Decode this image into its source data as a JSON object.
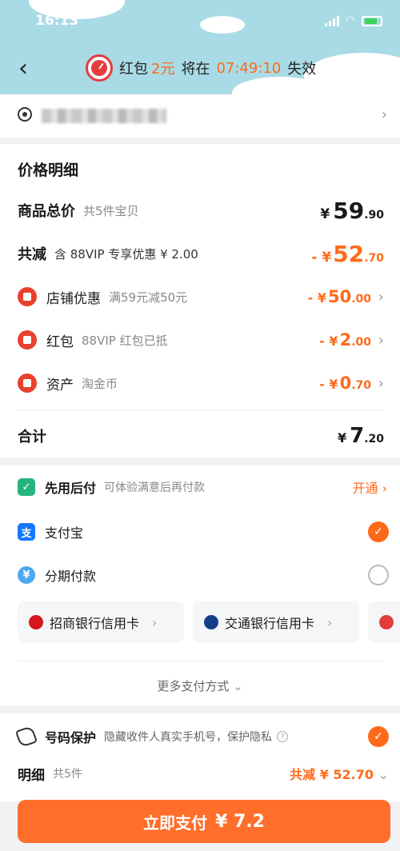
{
  "status": {
    "time": "16:13"
  },
  "header": {
    "countdown_prefix": "红包",
    "countdown_amount": "2元",
    "countdown_mid": "将在",
    "countdown_time": "07:49:10",
    "countdown_suffix": "失效"
  },
  "price": {
    "title": "价格明细",
    "total_label": "商品总价",
    "total_sub": "共5件宝贝",
    "total_currency": "¥",
    "total_int": "59",
    "total_dec": ".90",
    "discount_label": "共减",
    "discount_sub": "含 88VIP 专享优惠 ¥ 2.00",
    "discount_prefix": "- ¥",
    "discount_int": "52",
    "discount_dec": ".70",
    "items": [
      {
        "label": "店铺优惠",
        "sub": "满59元减50元",
        "prefix": "- ¥",
        "int": "50",
        "dec": ".00"
      },
      {
        "label": "红包",
        "sub": "88VIP 红包已抵",
        "prefix": "- ¥",
        "int": "2",
        "dec": ".00"
      },
      {
        "label": "资产",
        "sub": "淘金币",
        "prefix": "- ¥",
        "int": "0",
        "dec": ".70"
      }
    ],
    "sum_label": "合计",
    "sum_currency": "¥",
    "sum_int": "7",
    "sum_dec": ".20"
  },
  "payment": {
    "later_name": "先用后付",
    "later_desc": "可体验满意后再付款",
    "later_action": "开通",
    "alipay_name": "支付宝",
    "installment_name": "分期付款",
    "banks": [
      "招商银行信用卡",
      "交通银行信用卡"
    ],
    "more": "更多支付方式"
  },
  "privacy": {
    "name": "号码保护",
    "desc": "隐藏收件人真实手机号，保护隐私",
    "detail_label": "明细",
    "detail_count": "共5件",
    "detail_discount": "共减 ¥ 52.70"
  },
  "pay_button": {
    "label": "立即支付",
    "amount": "¥ 7.2"
  },
  "colors": {
    "accent": "#ff6a1a",
    "header_bg": "#a9dbe6",
    "pay_button": "#ff6e2a"
  }
}
